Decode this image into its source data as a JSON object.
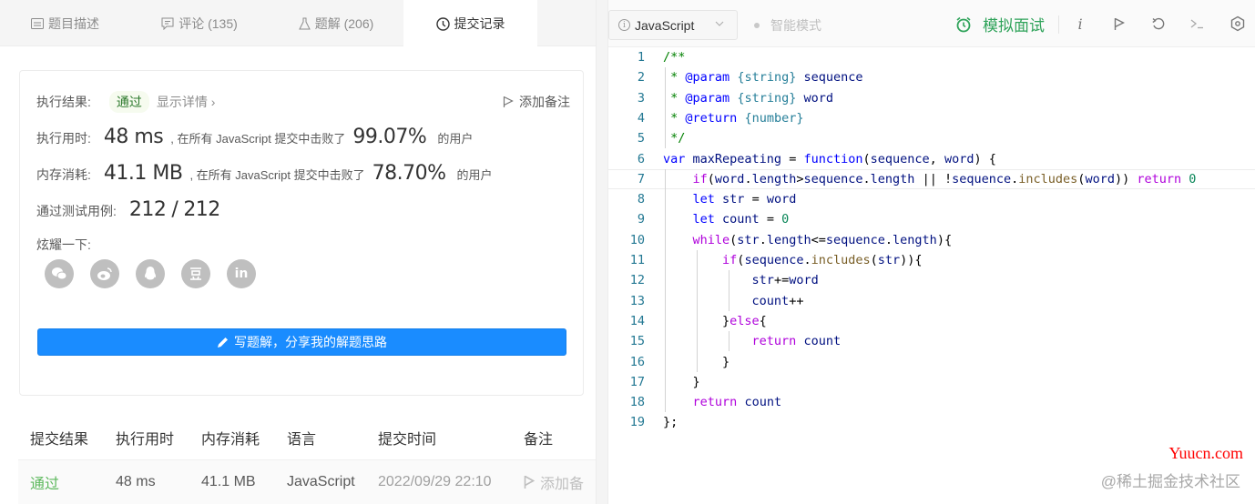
{
  "tabs": [
    {
      "label": "题目描述",
      "icon": "description-icon"
    },
    {
      "label": "评论 (135)",
      "icon": "comment-icon"
    },
    {
      "label": "题解 (206)",
      "icon": "flask-icon"
    },
    {
      "label": "提交记录",
      "icon": "clock-icon",
      "active": true
    }
  ],
  "result": {
    "label": "执行结果:",
    "status": "通过",
    "details_link": "显示详情 ›",
    "add_note": "添加备注",
    "runtime_label": "执行用时:",
    "runtime_value": "48 ms",
    "runtime_mid": ", 在所有 JavaScript 提交中击败了",
    "runtime_percent": "99.07%",
    "runtime_suffix": "的用户",
    "memory_label": "内存消耗:",
    "memory_value": "41.1 MB",
    "memory_mid": ", 在所有 JavaScript 提交中击败了",
    "memory_percent": "78.70%",
    "memory_suffix": "的用户",
    "cases_label": "通过测试用例:",
    "cases_passed": "212",
    "cases_sep": "/",
    "cases_total": "212",
    "share_label": "炫耀一下:",
    "share_icons": [
      "wechat-icon",
      "weibo-icon",
      "qq-icon",
      "douban-icon",
      "linkedin-icon"
    ],
    "write_button": "写题解，分享我的解题思路"
  },
  "submissions": {
    "headers": [
      "提交结果",
      "执行用时",
      "内存消耗",
      "语言",
      "提交时间",
      "备注"
    ],
    "rows": [
      {
        "result": "通过",
        "runtime": "48 ms",
        "memory": "41.1 MB",
        "language": "JavaScript",
        "time": "2022/09/29 22:10",
        "note": "添加备"
      }
    ]
  },
  "editor": {
    "language": "JavaScript",
    "smart_mode": "智能模式",
    "mock_interview": "模拟面试",
    "toolbar_icons": [
      "info-icon",
      "flag-icon",
      "reset-icon",
      "terminal-icon",
      "settings-icon"
    ],
    "code_lines": [
      "/**",
      " * @param {string} sequence",
      " * @param {string} word",
      " * @return {number}",
      " */",
      "var maxRepeating = function(sequence, word) {",
      "    if(word.length>sequence.length || !sequence.includes(word)) return 0",
      "    let str = word",
      "    let count = 0",
      "    while(str.length<=sequence.length){",
      "        if(sequence.includes(str)){",
      "            str+=word",
      "            count++",
      "        }else{",
      "            return count",
      "        }",
      "    }",
      "    return count",
      "};"
    ],
    "active_line": 7
  },
  "watermark": {
    "site": "Yuucn.com",
    "community": "@稀土掘金技术社区"
  },
  "colors": {
    "accent_blue": "#1a8cff",
    "success_green": "#5cb85c",
    "mock_green": "#2fa35a"
  }
}
